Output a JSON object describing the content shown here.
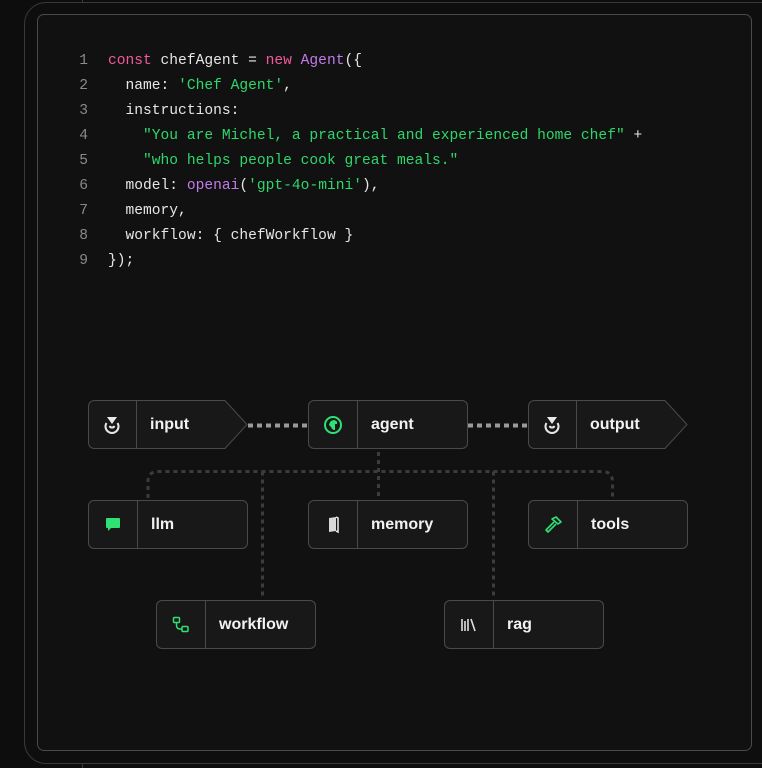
{
  "code": {
    "lines": [
      {
        "num": "1",
        "tokens": [
          {
            "t": "const ",
            "c": "kw"
          },
          {
            "t": "chefAgent = ",
            "c": "plain"
          },
          {
            "t": "new ",
            "c": "kw"
          },
          {
            "t": "Agent",
            "c": "fn"
          },
          {
            "t": "({",
            "c": "plain"
          }
        ]
      },
      {
        "num": "2",
        "tokens": [
          {
            "t": "  name: ",
            "c": "plain"
          },
          {
            "t": "'Chef Agent'",
            "c": "str"
          },
          {
            "t": ",",
            "c": "plain"
          }
        ]
      },
      {
        "num": "3",
        "tokens": [
          {
            "t": "  instructions:",
            "c": "plain"
          }
        ]
      },
      {
        "num": "4",
        "tokens": [
          {
            "t": "    ",
            "c": "plain"
          },
          {
            "t": "\"You are Michel, a practical and experienced home chef\"",
            "c": "str"
          },
          {
            "t": " +",
            "c": "plain"
          }
        ]
      },
      {
        "num": "5",
        "tokens": [
          {
            "t": "    ",
            "c": "plain"
          },
          {
            "t": "\"who helps people cook great meals.\"",
            "c": "str"
          }
        ]
      },
      {
        "num": "6",
        "tokens": [
          {
            "t": "  model: ",
            "c": "plain"
          },
          {
            "t": "openai",
            "c": "fn"
          },
          {
            "t": "(",
            "c": "plain"
          },
          {
            "t": "'gpt-4o-mini'",
            "c": "str"
          },
          {
            "t": "),",
            "c": "plain"
          }
        ]
      },
      {
        "num": "7",
        "tokens": [
          {
            "t": "  memory,",
            "c": "plain"
          }
        ]
      },
      {
        "num": "8",
        "tokens": [
          {
            "t": "  workflow: { chefWorkflow }",
            "c": "plain"
          }
        ]
      },
      {
        "num": "9",
        "tokens": [
          {
            "t": "});",
            "c": "plain"
          }
        ]
      }
    ]
  },
  "diagram": {
    "nodes": {
      "input": {
        "label": "input",
        "icon": "input-icon"
      },
      "agent": {
        "label": "agent",
        "icon": "agent-icon"
      },
      "output": {
        "label": "output",
        "icon": "output-icon"
      },
      "llm": {
        "label": "llm",
        "icon": "chat-bubble-icon"
      },
      "memory": {
        "label": "memory",
        "icon": "book-icon"
      },
      "tools": {
        "label": "tools",
        "icon": "hammer-icon"
      },
      "workflow": {
        "label": "workflow",
        "icon": "workflow-icon"
      },
      "rag": {
        "label": "rag",
        "icon": "library-icon"
      }
    }
  },
  "colors": {
    "accent": "#2fe074",
    "keyword": "#ee5a9a",
    "function": "#c17be8",
    "string": "#2fd66b",
    "panel_bg": "#111111",
    "node_bg": "#181818",
    "border": "#4a4a4a"
  }
}
